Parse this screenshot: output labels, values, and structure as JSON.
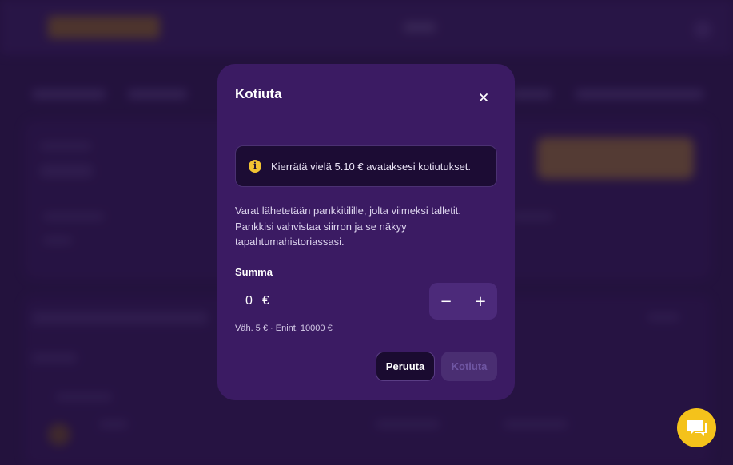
{
  "modal": {
    "title": "Kotiuta",
    "close_icon": "close-icon",
    "notice": {
      "icon": "info-icon",
      "text": "Kierrätä vielä 5.10 € avataksesi kotiutukset."
    },
    "info_lines": [
      "Varat lähetetään pankkitilille, jolta viimeksi talletit.",
      "Pankkisi vahvistaa siirron ja se näkyy",
      "tapahtumahistoriassasi."
    ],
    "amount": {
      "label": "Summa",
      "value": "0",
      "currency": "€",
      "decrement_label": "−",
      "increment_label": "+",
      "limits": "Väh. 5 € · Enint. 10000 €"
    },
    "cancel_label": "Peruuta",
    "withdraw_label": "Kotiuta"
  },
  "chat": {
    "icon": "chat-icon"
  },
  "colors": {
    "accent": "#f4c21b",
    "modal_bg": "#3b1b63",
    "notice_bg": "#1c0c34"
  }
}
